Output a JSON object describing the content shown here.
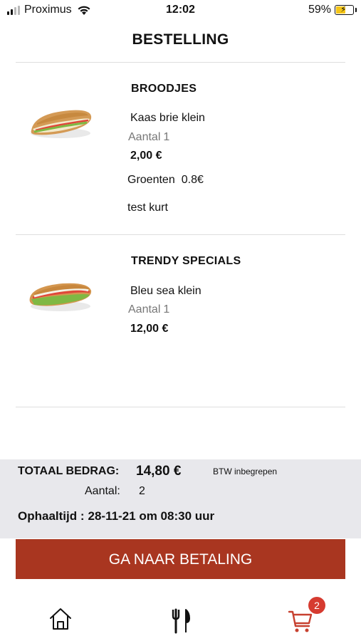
{
  "status_bar": {
    "carrier": "Proximus",
    "time": "12:02",
    "battery_percent": "59%",
    "icons": [
      "signal-icon",
      "wifi-icon",
      "battery-charging-icon"
    ]
  },
  "header": {
    "title": "BESTELLING"
  },
  "order_items": [
    {
      "category": "BROODJES",
      "product": "Kaas brie klein",
      "quantity_label": "Aantal",
      "quantity": "1",
      "price": "2,00 €",
      "extra_name": "Groenten",
      "extra_price": "0.8€",
      "note": "test kurt",
      "icon": "sandwich-image"
    },
    {
      "category": "TRENDY SPECIALS",
      "product": "Bleu sea klein",
      "quantity_label": "Aantal",
      "quantity": "1",
      "price": "12,00 €",
      "icon": "sandwich-image"
    }
  ],
  "summary": {
    "total_label": "TOTAAL BEDRAG:",
    "total_value": "14,80 €",
    "vat_note": "BTW inbegrepen",
    "count_label": "Aantal:",
    "count_value": "2",
    "pickup_label": "Ophaaltijd :",
    "pickup_value": "28-11-21 om 08:30 uur"
  },
  "actions": {
    "pay_label": "GA NAAR BETALING"
  },
  "tab_bar": {
    "tabs": [
      "home-icon",
      "fork-knife-icon",
      "cart-icon"
    ],
    "cart_badge": "2"
  },
  "colors": {
    "accent": "#a93620",
    "summary_bg": "#e8e8ec",
    "badge": "#d63b30",
    "cart_icon": "#c7402f"
  }
}
